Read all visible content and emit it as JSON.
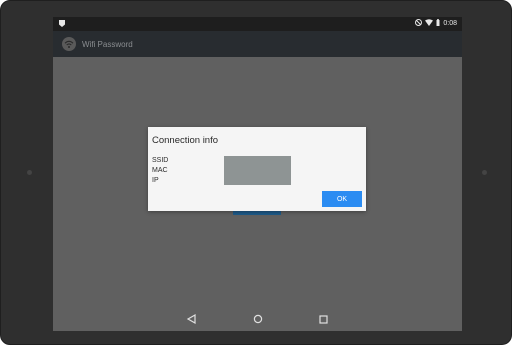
{
  "status_bar": {
    "time": "0:08",
    "icons": [
      "notification-icon",
      "do-not-disturb-icon",
      "wifi-icon",
      "battery-icon"
    ]
  },
  "app_bar": {
    "title": "Wifi Password",
    "icon": "wifi-icon"
  },
  "dialog": {
    "title": "Connection info",
    "labels": [
      "SSID",
      "MAC",
      "IP"
    ],
    "ok_label": "OK"
  },
  "nav_bar": {
    "icons": [
      "back-icon",
      "home-icon",
      "recents-icon"
    ]
  },
  "colors": {
    "ok_button": "#2b8cf2",
    "app_bar": "#282c30",
    "content": "#606060",
    "dialog_bg": "#f5f5f5",
    "value_box": "#8e9494"
  }
}
